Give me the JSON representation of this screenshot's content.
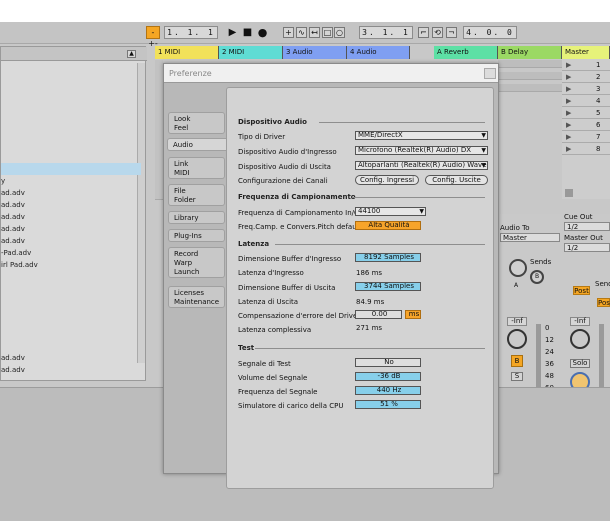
{
  "transport": {
    "tempo_display": "1. 1. 1",
    "position_display": "3. 1. 1",
    "length_display": "4. 0. 0",
    "play_icon": "play-icon",
    "stop_icon": "stop-icon",
    "record_icon": "record-icon"
  },
  "tracks": [
    {
      "label": "1 MIDI",
      "color": "#f2e15a"
    },
    {
      "label": "2 MIDI",
      "color": "#5fdcd4"
    },
    {
      "label": "3 Audio",
      "color": "#7f9ff2"
    },
    {
      "label": "4 Audio",
      "color": "#7f9ff2"
    },
    {
      "label": "A Reverb",
      "color": "#5de0a5"
    },
    {
      "label": "B Delay",
      "color": "#9bd964"
    },
    {
      "label": "Master",
      "color": "#e6f27a"
    }
  ],
  "master_scenes": [
    "1",
    "2",
    "3",
    "4",
    "5",
    "6",
    "7",
    "8"
  ],
  "browser_items": [
    "y",
    "ad.adv",
    "ad.adv",
    "ad.adv",
    "ad.adv",
    "ad.adv",
    "-Pad.adv",
    "irl Pad.adv",
    "ad.adv",
    "ad.adv"
  ],
  "mixer": {
    "audio_to_label": "Audio To",
    "audio_to_value": "Master",
    "sends_label_1": "Sends",
    "sends_label_2": "Sends",
    "cue_out_label": "Cue Out",
    "cue_out_value": "1/2",
    "master_out_label": "Master Out",
    "master_out_value": "1/2",
    "post_1": "Post",
    "post_2": "Post",
    "inf_1": "-Inf",
    "inf_2": "-Inf",
    "solo_label": "Solo",
    "s_label": "S",
    "b_label": "B",
    "knob_a": "A",
    "knob_b": "B",
    "meter_ticks": [
      "0",
      "12",
      "24",
      "36",
      "48",
      "60"
    ]
  },
  "dialog": {
    "title": "Preferenze",
    "nav": [
      {
        "label": "Look\nFeel",
        "active": false
      },
      {
        "label": "Audio",
        "active": true
      },
      {
        "label": "Link\nMIDI",
        "active": false
      },
      {
        "label": "File\nFolder",
        "active": false
      },
      {
        "label": "Library",
        "active": false
      },
      {
        "label": "Plug-Ins",
        "active": false
      },
      {
        "label": "Record\nWarp\nLaunch",
        "active": false
      },
      {
        "label": "Licenses\nMaintenance",
        "active": false
      }
    ],
    "audio_device": {
      "section": "Dispositivo Audio",
      "driver_type_label": "Tipo di Driver",
      "driver_type_value": "MME/DirectX",
      "input_label": "Dispositivo Audio d'Ingresso",
      "input_value": "Microfono (Realtek(R) Audio) DX",
      "output_label": "Dispositivo Audio di Uscita",
      "output_value": "Altoparlanti (Realtek(R) Audio) Wave",
      "channels_label": "Configurazione dei Canali",
      "config_inputs": "Config. Ingressi",
      "config_outputs": "Config. Uscite"
    },
    "sample_rate": {
      "section": "Frequenza di Campionamento",
      "rate_label": "Frequenza di Campionamento In/Out",
      "rate_value": "44100",
      "conv_label": "Freq.Camp. e Convers.Pitch default",
      "conv_value": "Alta Qualità"
    },
    "latency": {
      "section": "Latenza",
      "in_buffer_label": "Dimensione Buffer d'Ingresso",
      "in_buffer_value": "8192 Samples",
      "in_latency_label": "Latenza d'Ingresso",
      "in_latency_value": "186 ms",
      "out_buffer_label": "Dimensione Buffer di Uscita",
      "out_buffer_value": "3744 Samples",
      "out_latency_label": "Latenza di Uscita",
      "out_latency_value": "84.9 ms",
      "driver_comp_label": "Compensazione d'errore del Driver",
      "driver_comp_value": "0.00",
      "driver_comp_unit": "ms",
      "total_latency_label": "Latenza complessiva",
      "total_latency_value": "271 ms"
    },
    "test": {
      "section": "Test",
      "signal_label": "Segnale di Test",
      "signal_value": "No",
      "volume_label": "Volume del Segnale",
      "volume_value": "-36 dB",
      "freq_label": "Frequenza del Segnale",
      "freq_value": "440 Hz",
      "cpu_label": "Simulatore di carico della CPU",
      "cpu_value": "51 %"
    }
  }
}
